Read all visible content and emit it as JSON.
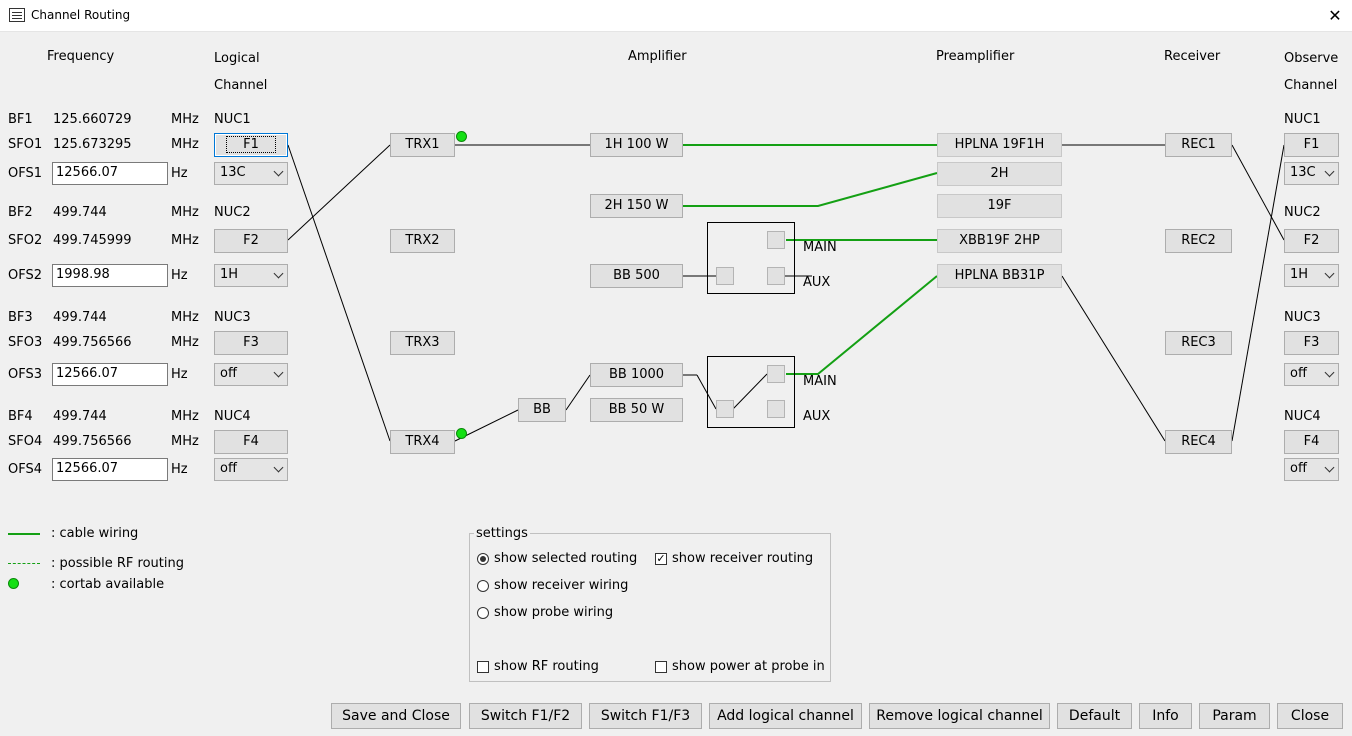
{
  "window": {
    "title": "Channel Routing",
    "close_glyph": "✕"
  },
  "headers": {
    "frequency": "Frequency",
    "logical_1": "Logical",
    "logical_2": "Channel",
    "amplifier": "Amplifier",
    "preamplifier": "Preamplifier",
    "receiver": "Receiver",
    "observe_1": "Observe",
    "observe_2": "Channel"
  },
  "channels": [
    {
      "bf_label": "BF1",
      "bf_value": "125.660729",
      "sfo_label": "SFO1",
      "sfo_value": "125.673295",
      "ofs_label": "OFS1",
      "ofs_value": "12566.07",
      "mhz": "MHz",
      "hz": "Hz",
      "nuc": "NUC1",
      "f_button": "F1",
      "nucleus": "13C"
    },
    {
      "bf_label": "BF2",
      "bf_value": "499.744",
      "sfo_label": "SFO2",
      "sfo_value": "499.745999",
      "ofs_label": "OFS2",
      "ofs_value": "1998.98",
      "mhz": "MHz",
      "hz": "Hz",
      "nuc": "NUC2",
      "f_button": "F2",
      "nucleus": "1H"
    },
    {
      "bf_label": "BF3",
      "bf_value": "499.744",
      "sfo_label": "SFO3",
      "sfo_value": "499.756566",
      "ofs_label": "OFS3",
      "ofs_value": "12566.07",
      "mhz": "MHz",
      "hz": "Hz",
      "nuc": "NUC3",
      "f_button": "F3",
      "nucleus": "off"
    },
    {
      "bf_label": "BF4",
      "bf_value": "499.744",
      "sfo_label": "SFO4",
      "sfo_value": "499.756566",
      "ofs_label": "OFS4",
      "ofs_value": "12566.07",
      "mhz": "MHz",
      "hz": "Hz",
      "nuc": "NUC4",
      "f_button": "F4",
      "nucleus": "off"
    }
  ],
  "transmitters": [
    "TRX1",
    "TRX2",
    "TRX3",
    "TRX4"
  ],
  "bb_box": "BB",
  "amplifiers": [
    "1H 100 W",
    "2H 150 W",
    "BB 500",
    "BB 1000",
    "BB 50 W"
  ],
  "switch_labels": {
    "main": "MAIN",
    "aux": "AUX"
  },
  "preamplifiers": [
    "HPLNA 19F1H",
    "2H",
    "19F",
    "XBB19F 2HP",
    "HPLNA BB31P"
  ],
  "receivers": [
    "REC1",
    "REC2",
    "REC3",
    "REC4"
  ],
  "observe": [
    {
      "nuc": "NUC1",
      "f_button": "F1",
      "nucleus": "13C"
    },
    {
      "nuc": "NUC2",
      "f_button": "F2",
      "nucleus": "1H"
    },
    {
      "nuc": "NUC3",
      "f_button": "F3",
      "nucleus": "off"
    },
    {
      "nuc": "NUC4",
      "f_button": "F4",
      "nucleus": "off"
    }
  ],
  "legend": {
    "cable_wiring": ": cable wiring",
    "possible_rf": ": possible RF routing",
    "cortab": ": cortab available"
  },
  "settings": {
    "title": "settings",
    "show_selected_routing": {
      "label": "show selected routing",
      "checked": true
    },
    "show_receiver_wiring": {
      "label": "show receiver wiring",
      "checked": false
    },
    "show_probe_wiring": {
      "label": "show probe wiring",
      "checked": false
    },
    "show_receiver_routing": {
      "label": "show receiver routing",
      "checked": true
    },
    "show_rf_routing": {
      "label": "show RF routing",
      "checked": false
    },
    "show_power_at_probe_in": {
      "label": "show power at probe in",
      "checked": false
    }
  },
  "buttons": {
    "save_close": "Save and Close",
    "switch_f1f2": "Switch F1/F2",
    "switch_f1f3": "Switch F1/F3",
    "add_logical": "Add logical channel",
    "remove_logical": "Remove logical channel",
    "default": "Default",
    "info": "Info",
    "param": "Param",
    "close": "Close"
  },
  "colors": {
    "cable": "#14a014",
    "cortab": "#14e014",
    "accent": "#0078d7"
  }
}
